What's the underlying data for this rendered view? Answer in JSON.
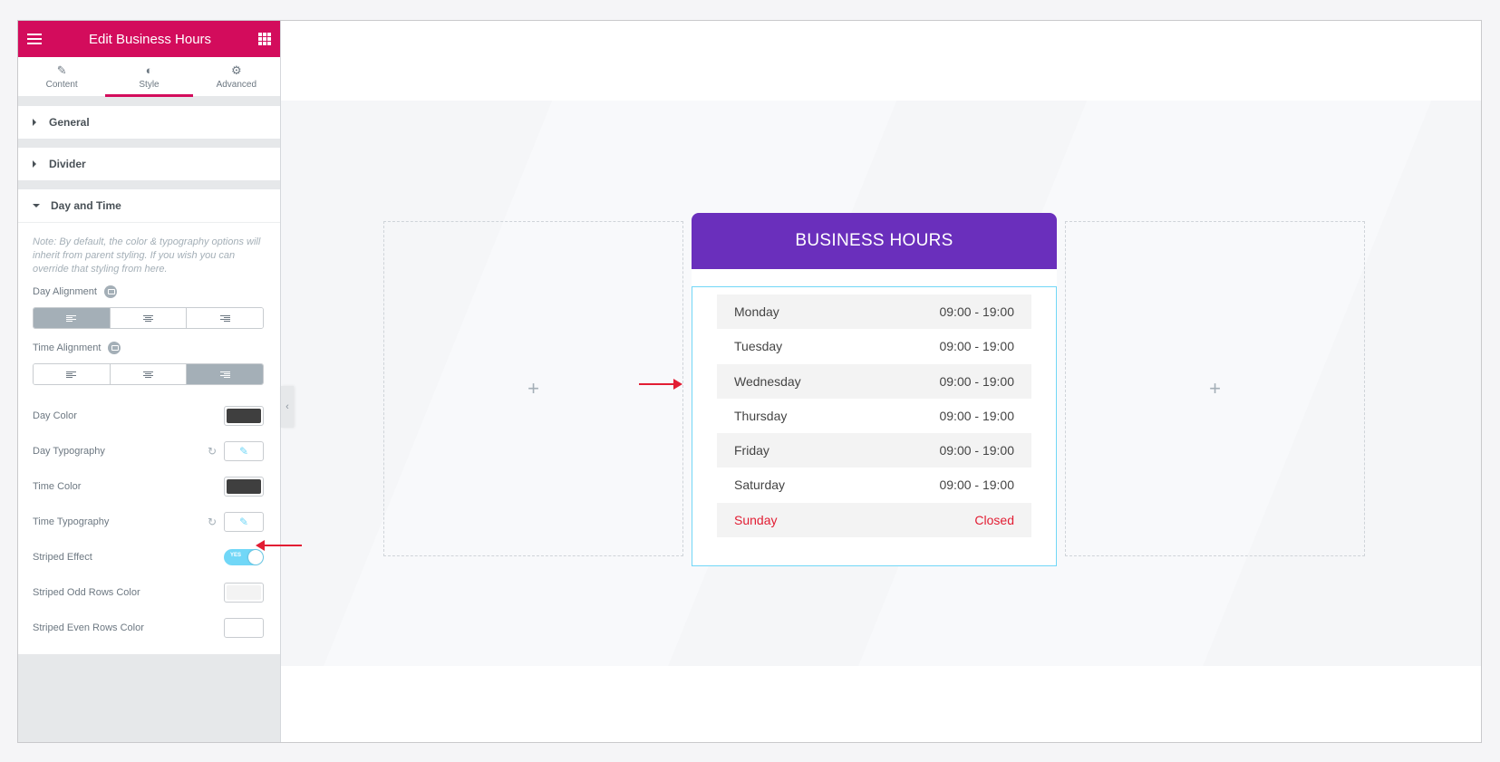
{
  "panel": {
    "title": "Edit Business Hours",
    "tabs": [
      {
        "label": "Content",
        "icon": "pencil-icon"
      },
      {
        "label": "Style",
        "icon": "contrast-icon"
      },
      {
        "label": "Advanced",
        "icon": "gear-icon"
      }
    ],
    "sections": {
      "general": "General",
      "divider": "Divider",
      "day_time": "Day and Time"
    },
    "note": "Note: By default, the color & typography options will inherit from parent styling. If you wish you can override that styling from here.",
    "controls": {
      "day_alignment": "Day Alignment",
      "time_alignment": "Time Alignment",
      "day_color": "Day Color",
      "day_typography": "Day Typography",
      "time_color": "Time Color",
      "time_typography": "Time Typography",
      "striped_effect": "Striped Effect",
      "striped_toggle": "YES",
      "striped_odd": "Striped Odd Rows Color",
      "striped_even": "Striped Even Rows Color"
    },
    "colors": {
      "accent": "#d30c5c",
      "day_color": "#3f3f3f",
      "time_color": "#3f3f3f",
      "odd_rows": "#f3f3f3",
      "even_rows": "#ffffff"
    }
  },
  "widget": {
    "title": "BUSINESS HOURS",
    "header_color": "#6a2fbc",
    "rows": [
      {
        "day": "Monday",
        "time": "09:00 - 19:00"
      },
      {
        "day": "Tuesday",
        "time": "09:00 - 19:00"
      },
      {
        "day": "Wednesday",
        "time": "09:00 - 19:00"
      },
      {
        "day": "Thursday",
        "time": "09:00 - 19:00"
      },
      {
        "day": "Friday",
        "time": "09:00 - 19:00"
      },
      {
        "day": "Saturday",
        "time": "09:00 - 19:00"
      },
      {
        "day": "Sunday",
        "time": "Closed"
      }
    ]
  },
  "canvas": {
    "add_icon": "+"
  }
}
